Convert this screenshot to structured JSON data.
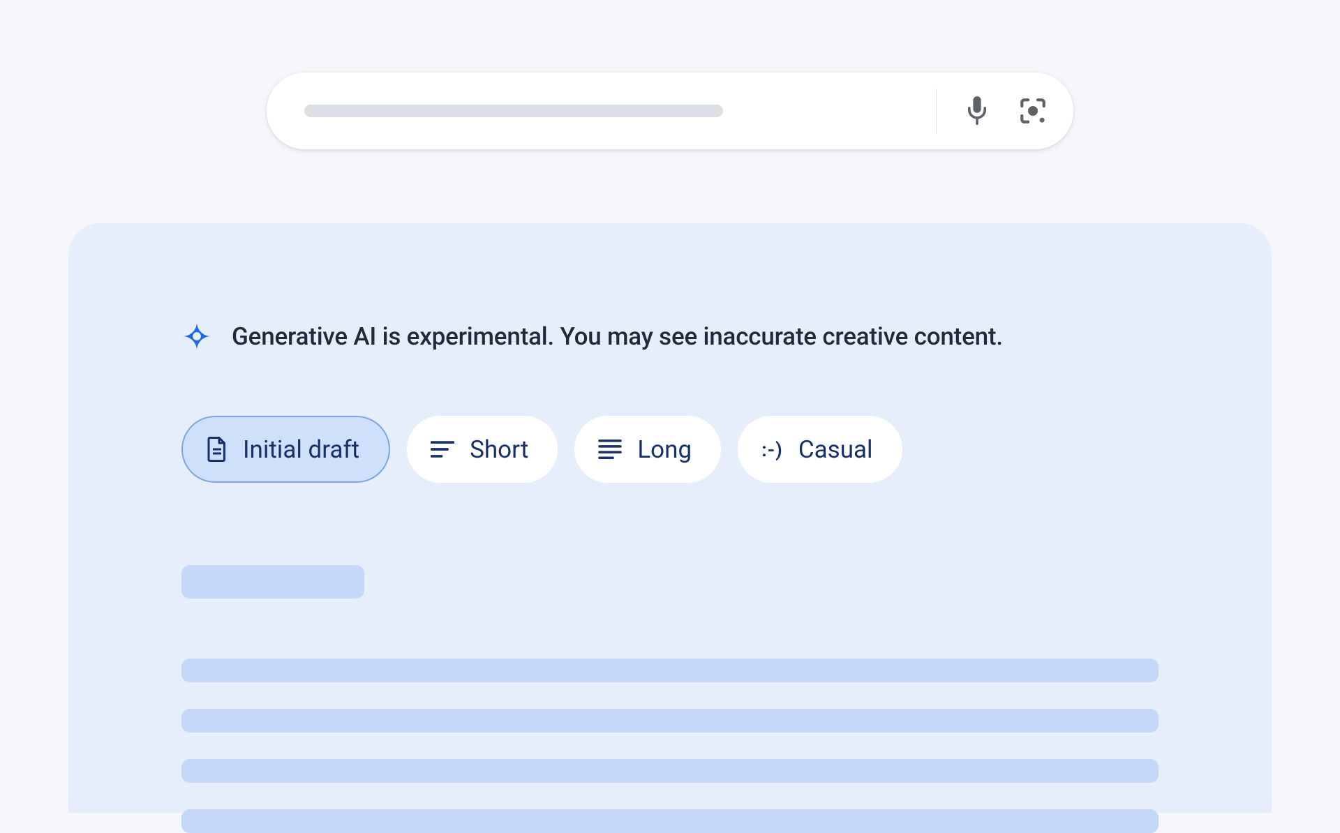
{
  "notice": {
    "text": "Generative AI is experimental. You may see inaccurate creative content."
  },
  "chips": [
    {
      "label": "Initial draft",
      "icon": "document-icon",
      "selected": true
    },
    {
      "label": "Short",
      "icon": "short-lines-icon",
      "selected": false
    },
    {
      "label": "Long",
      "icon": "long-lines-icon",
      "selected": false
    },
    {
      "label": "Casual",
      "icon": "smiley-icon",
      "selected": false
    }
  ],
  "colors": {
    "page_bg": "#f5f7fb",
    "panel_bg": "#e6eefc",
    "skeleton": "#c5d8f7",
    "chip_selected_bg": "#cfe0fb",
    "chip_selected_border": "#7ea6e6",
    "text_primary": "#173067",
    "icon_muted": "#5f6368",
    "sparkle": "#1a6be0"
  }
}
